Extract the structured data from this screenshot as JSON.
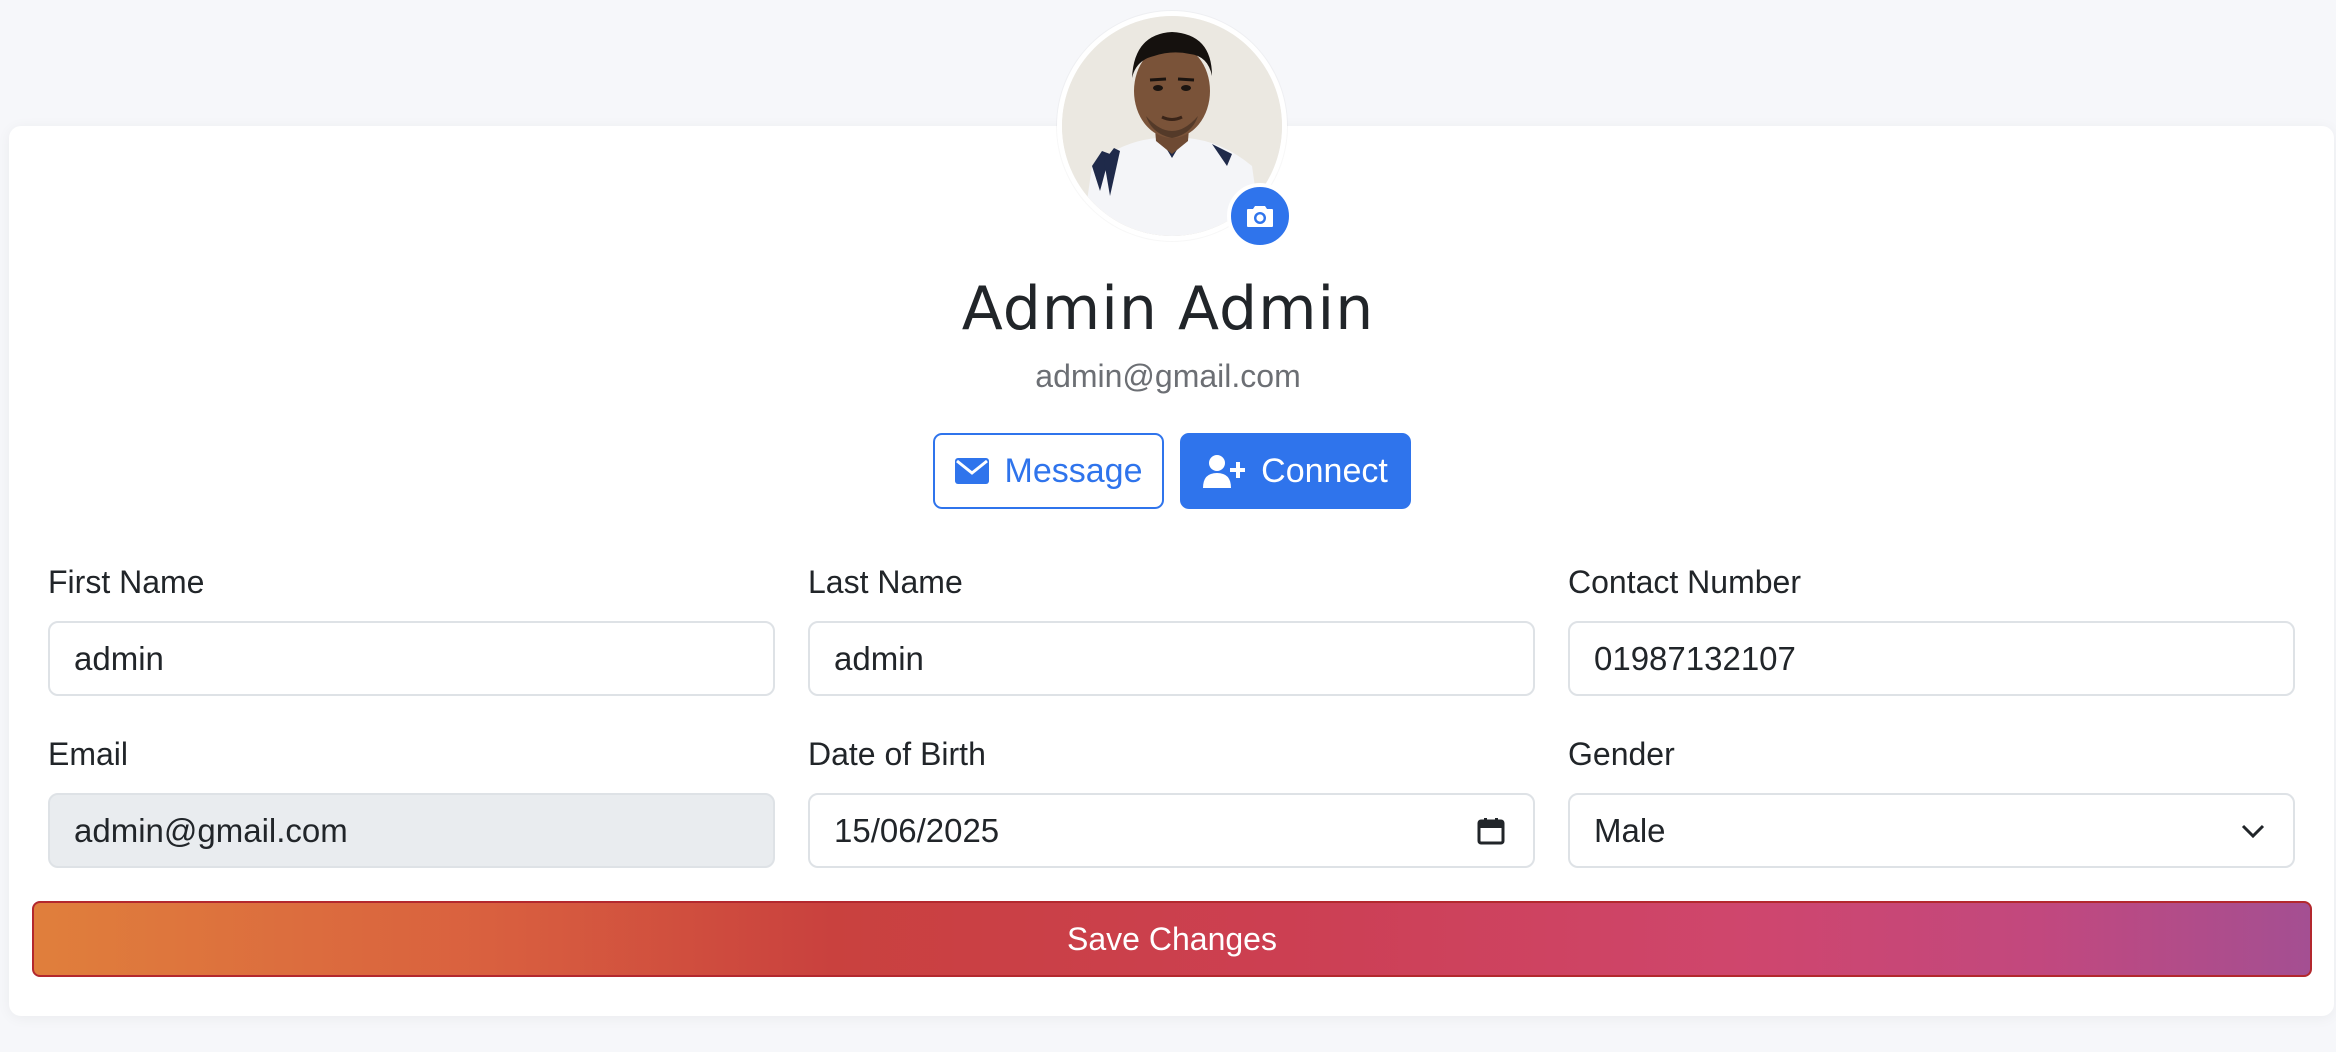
{
  "profile": {
    "name": "Admin Admin",
    "email": "admin@gmail.com"
  },
  "actions": {
    "message_label": "Message",
    "connect_label": "Connect"
  },
  "form": {
    "first_name": {
      "label": "First Name",
      "value": "admin"
    },
    "last_name": {
      "label": "Last Name",
      "value": "admin"
    },
    "contact": {
      "label": "Contact Number",
      "value": "01987132107"
    },
    "email": {
      "label": "Email",
      "value": "admin@gmail.com"
    },
    "dob": {
      "label": "Date of Birth",
      "value": "15/06/2025"
    },
    "gender": {
      "label": "Gender",
      "value": "Male"
    }
  },
  "save_label": "Save Changes",
  "icons": {
    "camera": "camera-icon",
    "envelope": "envelope-icon",
    "user_plus": "user-plus-icon",
    "calendar": "calendar-icon",
    "chevron": "chevron-down-icon"
  },
  "colors": {
    "primary": "#2f74ec",
    "save_gradient_start": "#e07f3c",
    "save_gradient_end": "#a44f92",
    "readonly_bg": "#e9ecef"
  }
}
